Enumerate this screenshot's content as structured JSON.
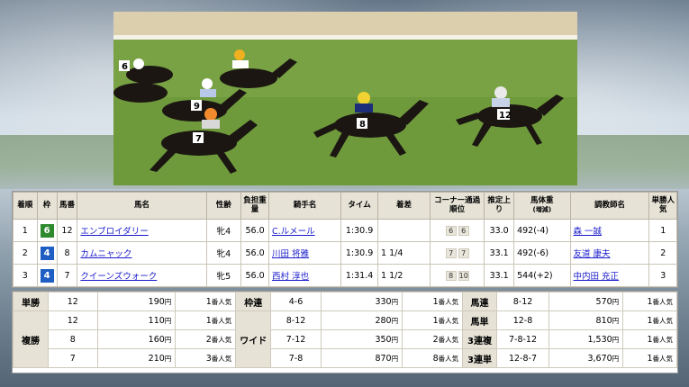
{
  "colors": {
    "header_bg": "#e6e2d6",
    "waku_6": "#2f8a2f",
    "waku_4": "#1f5fc4",
    "link": "#1a1acc"
  },
  "results": {
    "headers": {
      "rank": "着順",
      "waku": "枠",
      "number": "馬番",
      "name": "馬名",
      "sex_age": "性齢",
      "weight_carried": "負担重量",
      "jockey": "騎手名",
      "time": "タイム",
      "margin": "着差",
      "corners": "コーナー通過順位",
      "last3f": "推定上り",
      "horse_weight": "馬体重",
      "horse_weight_sub": "(増減)",
      "trainer": "調教師名",
      "popularity": "単勝人気"
    },
    "rows": [
      {
        "rank": "1",
        "waku": "6",
        "waku_color": "#2f8a2f",
        "number": "12",
        "name": "エンブロイダリー",
        "sex_age": "牝4",
        "weight": "56.0",
        "jockey": "C.ルメール",
        "time": "1:30.9",
        "margin": "",
        "corner1": "6",
        "corner2": "6",
        "last3f": "33.0",
        "horse_weight": "492(-4)",
        "trainer": "森 一誠",
        "popularity": "1"
      },
      {
        "rank": "2",
        "waku": "4",
        "waku_color": "#1f5fc4",
        "number": "8",
        "name": "カムニャック",
        "sex_age": "牝4",
        "weight": "56.0",
        "jockey": "川田 将雅",
        "time": "1:30.9",
        "margin": "1 1/4",
        "corner1": "7",
        "corner2": "7",
        "last3f": "33.1",
        "horse_weight": "492(-6)",
        "trainer": "友道 康夫",
        "popularity": "2"
      },
      {
        "rank": "3",
        "waku": "4",
        "waku_color": "#1f5fc4",
        "number": "7",
        "name": "クイーンズウォーク",
        "sex_age": "牝5",
        "weight": "56.0",
        "jockey": "西村 淳也",
        "time": "1:31.4",
        "margin": "1 1/2",
        "corner1": "8",
        "corner2": "10",
        "last3f": "33.1",
        "horse_weight": "544(+2)",
        "trainer": "中内田 充正",
        "popularity": "3"
      }
    ]
  },
  "payout": {
    "yen": "円",
    "ninki": "番人気",
    "tansho": {
      "label": "単勝",
      "combo": "12",
      "amount": "190",
      "pop": "1"
    },
    "fukusho": {
      "label": "複勝",
      "rows": [
        {
          "combo": "12",
          "amount": "110",
          "pop": "1"
        },
        {
          "combo": "8",
          "amount": "160",
          "pop": "2"
        },
        {
          "combo": "7",
          "amount": "210",
          "pop": "3"
        }
      ]
    },
    "wakuren": {
      "label": "枠連",
      "combo": "4-6",
      "amount": "330",
      "pop": "1"
    },
    "wide": {
      "label": "ワイド",
      "rows": [
        {
          "combo": "8-12",
          "amount": "280",
          "pop": "1"
        },
        {
          "combo": "7-12",
          "amount": "350",
          "pop": "2"
        },
        {
          "combo": "7-8",
          "amount": "870",
          "pop": "8"
        }
      ]
    },
    "umaren": {
      "label": "馬連",
      "combo": "8-12",
      "amount": "570",
      "pop": "1"
    },
    "umatan": {
      "label": "馬単",
      "combo": "12-8",
      "amount": "810",
      "pop": "1"
    },
    "sanrenpuku": {
      "label": "3連複",
      "combo": "7-8-12",
      "amount": "1,530",
      "pop": "1"
    },
    "sanrentan": {
      "label": "3連単",
      "combo": "12-8-7",
      "amount": "3,670",
      "pop": "1"
    }
  }
}
